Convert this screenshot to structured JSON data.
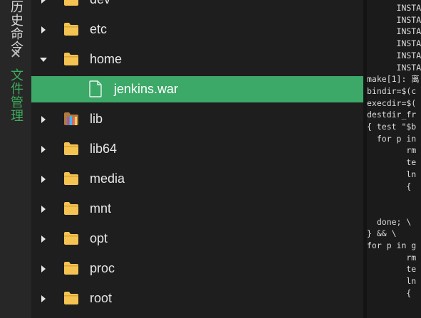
{
  "sidebar": {
    "tabs": [
      {
        "label": "历史命令"
      },
      {
        "label": "文件管理"
      }
    ]
  },
  "tree": {
    "items": [
      {
        "name": "dev",
        "type": "folder",
        "expanded": false,
        "selected": false
      },
      {
        "name": "etc",
        "type": "folder",
        "expanded": false,
        "selected": false
      },
      {
        "name": "home",
        "type": "folder",
        "expanded": true,
        "selected": false
      },
      {
        "name": "jenkins.war",
        "type": "file",
        "expanded": false,
        "selected": true
      },
      {
        "name": "lib",
        "type": "archive-folder",
        "expanded": false,
        "selected": false
      },
      {
        "name": "lib64",
        "type": "folder",
        "expanded": false,
        "selected": false
      },
      {
        "name": "media",
        "type": "folder",
        "expanded": false,
        "selected": false
      },
      {
        "name": "mnt",
        "type": "folder",
        "expanded": false,
        "selected": false
      },
      {
        "name": "opt",
        "type": "folder",
        "expanded": false,
        "selected": false
      },
      {
        "name": "proc",
        "type": "folder",
        "expanded": false,
        "selected": false
      },
      {
        "name": "root",
        "type": "folder",
        "expanded": false,
        "selected": false
      }
    ]
  },
  "terminal": {
    "lines": [
      "      INSTAL",
      "      INSTAL",
      "      INSTAL",
      "      INSTAL",
      "      INSTAL",
      "      INSTAL",
      "make[1]: 离",
      "bindir=$(c",
      "execdir=$(",
      "destdir_fr",
      "{ test \"$b",
      "  for p in",
      "        rm",
      "        te",
      "        ln",
      "        {",
      "",
      "",
      "  done; \\",
      "} && \\",
      "for p in g",
      "        rm",
      "        te",
      "        ln",
      "        {"
    ]
  },
  "colors": {
    "selected_row": "#3ca968",
    "active_tab": "#3dac5c",
    "folder": "#f4c351"
  }
}
